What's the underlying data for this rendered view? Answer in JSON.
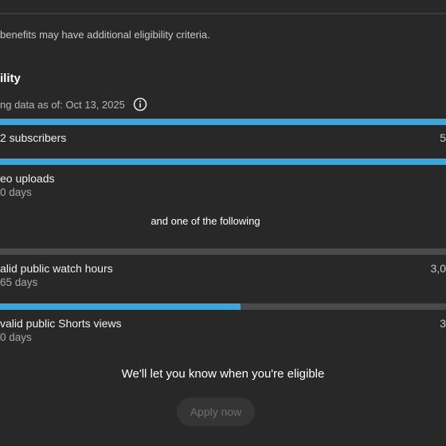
{
  "note": "benefits may have additional eligibility criteria.",
  "section": {
    "heading": "ility",
    "data_as_of": "ng data as of: Oct 13, 2025"
  },
  "colors": {
    "bar_fill": "#3ea6d6",
    "bar_track": "#4a4a4a",
    "background": "#282828"
  },
  "requirements": [
    {
      "label": "2 subscribers",
      "sub": "",
      "right": "5",
      "progress": 1.0
    },
    {
      "label": "eo uploads",
      "sub": "0 days",
      "right": "",
      "progress": 1.0
    },
    {
      "label": "alid public watch hours",
      "sub": "65 days",
      "right": "3,0",
      "progress": 0.0
    },
    {
      "label": "valid public Shorts views",
      "sub": "0 days",
      "right": "3",
      "progress": 0.54
    }
  ],
  "and_one_of": "and one of the following",
  "eligible_message": "We'll let you know when you're eligible",
  "apply_button": "Apply now"
}
